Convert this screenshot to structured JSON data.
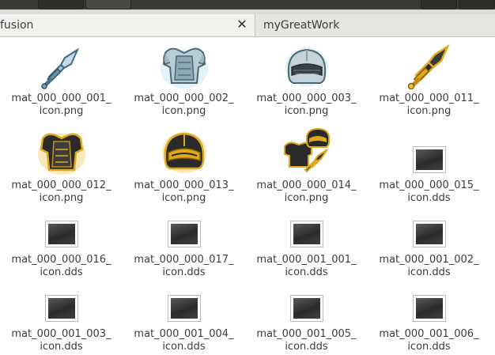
{
  "tabs": [
    {
      "label": "fusion",
      "close": "✕",
      "active": true
    },
    {
      "label": "myGreatWork",
      "active": false
    }
  ],
  "files": [
    {
      "name": "mat_000_000_001_\nicon.png",
      "icon": "sword-icon",
      "type": "png"
    },
    {
      "name": "mat_000_000_002_\nicon.png",
      "icon": "chest-armor-icon",
      "type": "png"
    },
    {
      "name": "mat_000_000_003_\nicon.png",
      "icon": "helmet-icon",
      "type": "png"
    },
    {
      "name": "mat_000_000_011_\nicon.png",
      "icon": "golden-sword-icon",
      "type": "png"
    },
    {
      "name": "mat_000_000_012_\nicon.png",
      "icon": "golden-chest-armor-icon",
      "type": "png"
    },
    {
      "name": "mat_000_000_013_\nicon.png",
      "icon": "golden-helmet-icon",
      "type": "png"
    },
    {
      "name": "mat_000_000_014_\nicon.png",
      "icon": "armor-set-icon",
      "type": "png"
    },
    {
      "name": "mat_000_000_015_\nicon.dds",
      "icon": "dds-thumbnail-icon",
      "type": "dds"
    },
    {
      "name": "mat_000_000_016_\nicon.dds",
      "icon": "dds-thumbnail-icon",
      "type": "dds"
    },
    {
      "name": "mat_000_000_017_\nicon.dds",
      "icon": "dds-thumbnail-icon",
      "type": "dds"
    },
    {
      "name": "mat_000_001_001_\nicon.dds",
      "icon": "dds-thumbnail-icon",
      "type": "dds"
    },
    {
      "name": "mat_000_001_002_\nicon.dds",
      "icon": "dds-thumbnail-icon",
      "type": "dds"
    },
    {
      "name": "mat_000_001_003_\nicon.dds",
      "icon": "dds-thumbnail-icon",
      "type": "dds"
    },
    {
      "name": "mat_000_001_004_\nicon.dds",
      "icon": "dds-thumbnail-icon",
      "type": "dds"
    },
    {
      "name": "mat_000_001_005_\nicon.dds",
      "icon": "dds-thumbnail-icon",
      "type": "dds"
    },
    {
      "name": "mat_000_001_006_\nicon.dds",
      "icon": "dds-thumbnail-icon",
      "type": "dds"
    }
  ],
  "colors": {
    "header": "#3b3a36",
    "tabbar": "#dcdcd9",
    "active_tab": "#f1f1ef",
    "steel": "#8fb3c4",
    "gold": "#e0a81c",
    "dark_metal": "#2a2a2a"
  }
}
